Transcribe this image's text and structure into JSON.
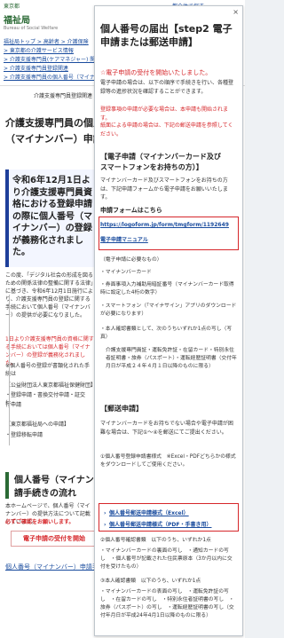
{
  "top_bar": {
    "logo": "東京都",
    "sitemap": "都全体で探す"
  },
  "site": {
    "name": "福祉局",
    "tagline": "Bureau of Social Welfare"
  },
  "breadcrumb": [
    "福祉局トップ > 高齢者 > 介護保険",
    "> 東京都の介護サービス情報",
    "> 介護支援専門員(ケアマネジャー) 関連",
    "> 介護支援専門員登録関連",
    "> 介護支援専門員の個人番号（マイナンバー）の手続"
  ],
  "tab_labels": [
    "介護支援専門員登録関連",
    "介護"
  ],
  "page_title": [
    "介護支援専門員の個人",
    "（マイナンバー）申請"
  ],
  "notice": {
    "text": "令和6年12月1日より介護支援専門員資格における登録申請の際に個人番号（マイナンバー）の登録が義務化されました。"
  },
  "body_text": [
    "この度、「デジタル社会の形成を図るための関係法律の整備に関する法律」に基づき、令和6年12月1日施行により、介護支援専門員の登録に関する手続において個人番号（マイナンバー）の提供が必要になりました。",
    "1日より介護支援専門員の資格に関する手続においては個人番号（マイナンバー）の登録が義務化されました。",
    "※個人番号の登録が書類化された手続は",
    "【公益財団法人東京都福祉保健財団】",
    "・登録申請・書換交付申請・証交付・",
    "付申請",
    "【東京都福祉局への申請】",
    "・登録移転申請"
  ],
  "section2_title": [
    "個人番号（マイナン",
    "請手続きの流れ"
  ],
  "section2_text": [
    "本ホームページで、個人番号（マイナンバー）の提供方法について記載しています。",
    "必ずご確認をお願いします。"
  ],
  "bg_button": "電子申請の受付を開始",
  "bg_link": "個人番号（マイナンバー）申請手続",
  "overlay": {
    "close": "×",
    "title": [
      "個人番号の届出【step2 電子",
      "申請または郵送申請】"
    ],
    "ereq_heading": "☆電子申請の受付を開始いたしました。",
    "ereq_text_1": "電子申請の場合は、以下の順序で手続きを行い、各種登録等の進捗状況を確認することができます。",
    "ereq_text_2": "登録事項の申請が必要な場合は、本申請も開始されます。",
    "ereq_text_3": "紙面による申請の場合は、下記の郵送申請を参照してください。",
    "h_e": [
      "【電子申請（マイナンバーカード及び",
      "スマートフォンをお持ちの方）】"
    ],
    "e_text": "マイナンバーカード及びスマートフォンをお持ちの方は、下記申請フォームから電子申請をお願いいたします。",
    "form_label": "申請フォームはこちら",
    "form_url": "https://logoform.jp/form/tmgform/1192649",
    "manual": "電子申請マニュアル",
    "need_label": "（電子申請に必要なもの）",
    "need_items": [
      "・マイナンバーカード",
      "・券面事項入力補助用暗証番号（マイナンバーカード取得時に設定した4桁の数字）",
      "・スマートフォン（「マイナサイン」アプリのダウンロードが必要になります）",
      "・本人確認書類として、次のうちいずれか1点の写し（写真）",
      "介護支援専門員証・運転免許証・在留カード・特別永住者証明書・旅券（パスポート）・運転経歴証明書（交付年月日が平成２４年４月１日以降のものに限る）"
    ],
    "h_mail": "【郵送申請】",
    "mail_text": "マイナンバーカードをお持ちでない場合や電子申請が困難な場合は、下記①〜④を郵送にてご提出ください。",
    "mail_items": [
      "①個人番号登録申請書様式　※Excel・PDFどちらかの様式をダウンロードしてご使用ください。"
    ],
    "dl_excel": "個人番号郵送申請様式（Excel）",
    "dl_pdf": "個人番号郵送申請様式（PDF・手書き用）",
    "after": [
      "②個人番号確認書類　以下のうち、いずれか1点",
      "・マイナンバーカードの裏面の写し　・通知カードの写し　・個人番号が記載された住民票原本（3か月以内に交付を受けたもの）",
      "③本人確認書類　以下のうち、いずれか1点",
      "・マイナンバーカードの表面の写し　・運転免許証の写し　・在留カードの写し　・特別永住者証明書の写し　・旅券（パスポート）の写し　・運転経歴証明書の写し（交付年月日が平成24年4月1日以降のものに限る）"
    ]
  }
}
